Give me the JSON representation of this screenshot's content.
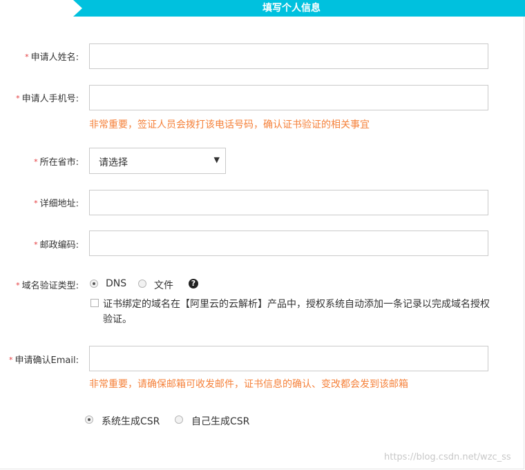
{
  "header": {
    "title": "填写个人信息"
  },
  "form": {
    "name_label": "申请人姓名:",
    "phone_label": "申请人手机号:",
    "phone_hint": "非常重要，签证人员会拨打该电话号码，确认证书验证的相关事宜",
    "province_label": "所在省市:",
    "province_value": "请选择",
    "address_label": "详细地址:",
    "postcode_label": "邮政编码:",
    "domain_verify_label": "域名验证类型:",
    "verify_options": [
      "DNS",
      "文件"
    ],
    "verify_selected": "DNS",
    "help_glyph": "?",
    "auto_dns_text": "证书绑定的域名在【阿里云的云解析】产品中，授权系统自动添加一条记录以完成域名授权验证。",
    "email_label": "申请确认Email:",
    "email_hint": "非常重要，请确保邮箱可收发邮件，证书信息的确认、变改都会发到该邮箱",
    "csr_options": [
      "系统生成CSR",
      "自己生成CSR"
    ],
    "csr_selected": "系统生成CSR"
  },
  "required_mark": "*",
  "watermark": "https://blog.csdn.net/wzc_ss",
  "colors": {
    "accent": "#00c1de",
    "hint": "#f5813a",
    "required": "#e4393c"
  }
}
